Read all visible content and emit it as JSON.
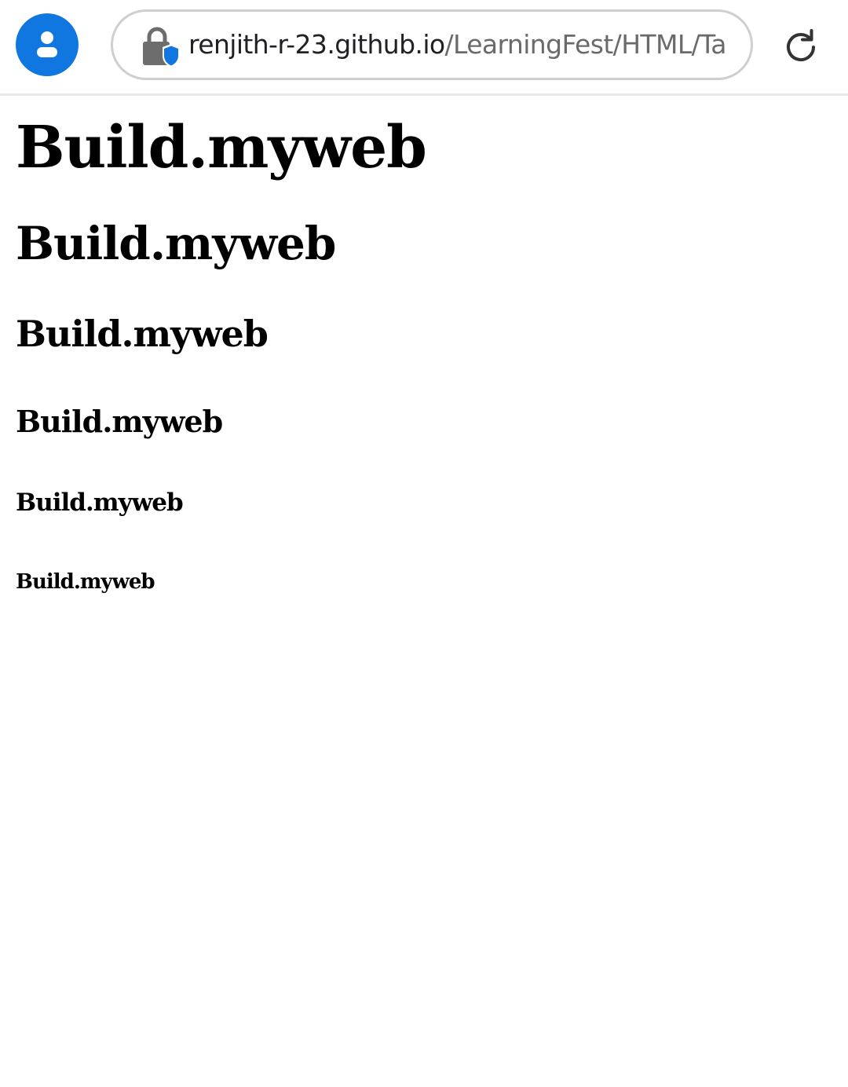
{
  "browser": {
    "url_host": "renjith-r-23.github.io",
    "url_path": "/LearningFest/HTML/Ta",
    "profile_icon": "account-circle-icon",
    "lock_icon": "lock-shield-icon",
    "reload_icon": "reload-icon",
    "accent_color": "#1177e0"
  },
  "page": {
    "headings": [
      {
        "level": 1,
        "text": "Build.myweb"
      },
      {
        "level": 2,
        "text": "Build.myweb"
      },
      {
        "level": 3,
        "text": "Build.myweb"
      },
      {
        "level": 4,
        "text": "Build.myweb"
      },
      {
        "level": 5,
        "text": "Build.myweb"
      },
      {
        "level": 6,
        "text": "Build.myweb"
      }
    ]
  }
}
